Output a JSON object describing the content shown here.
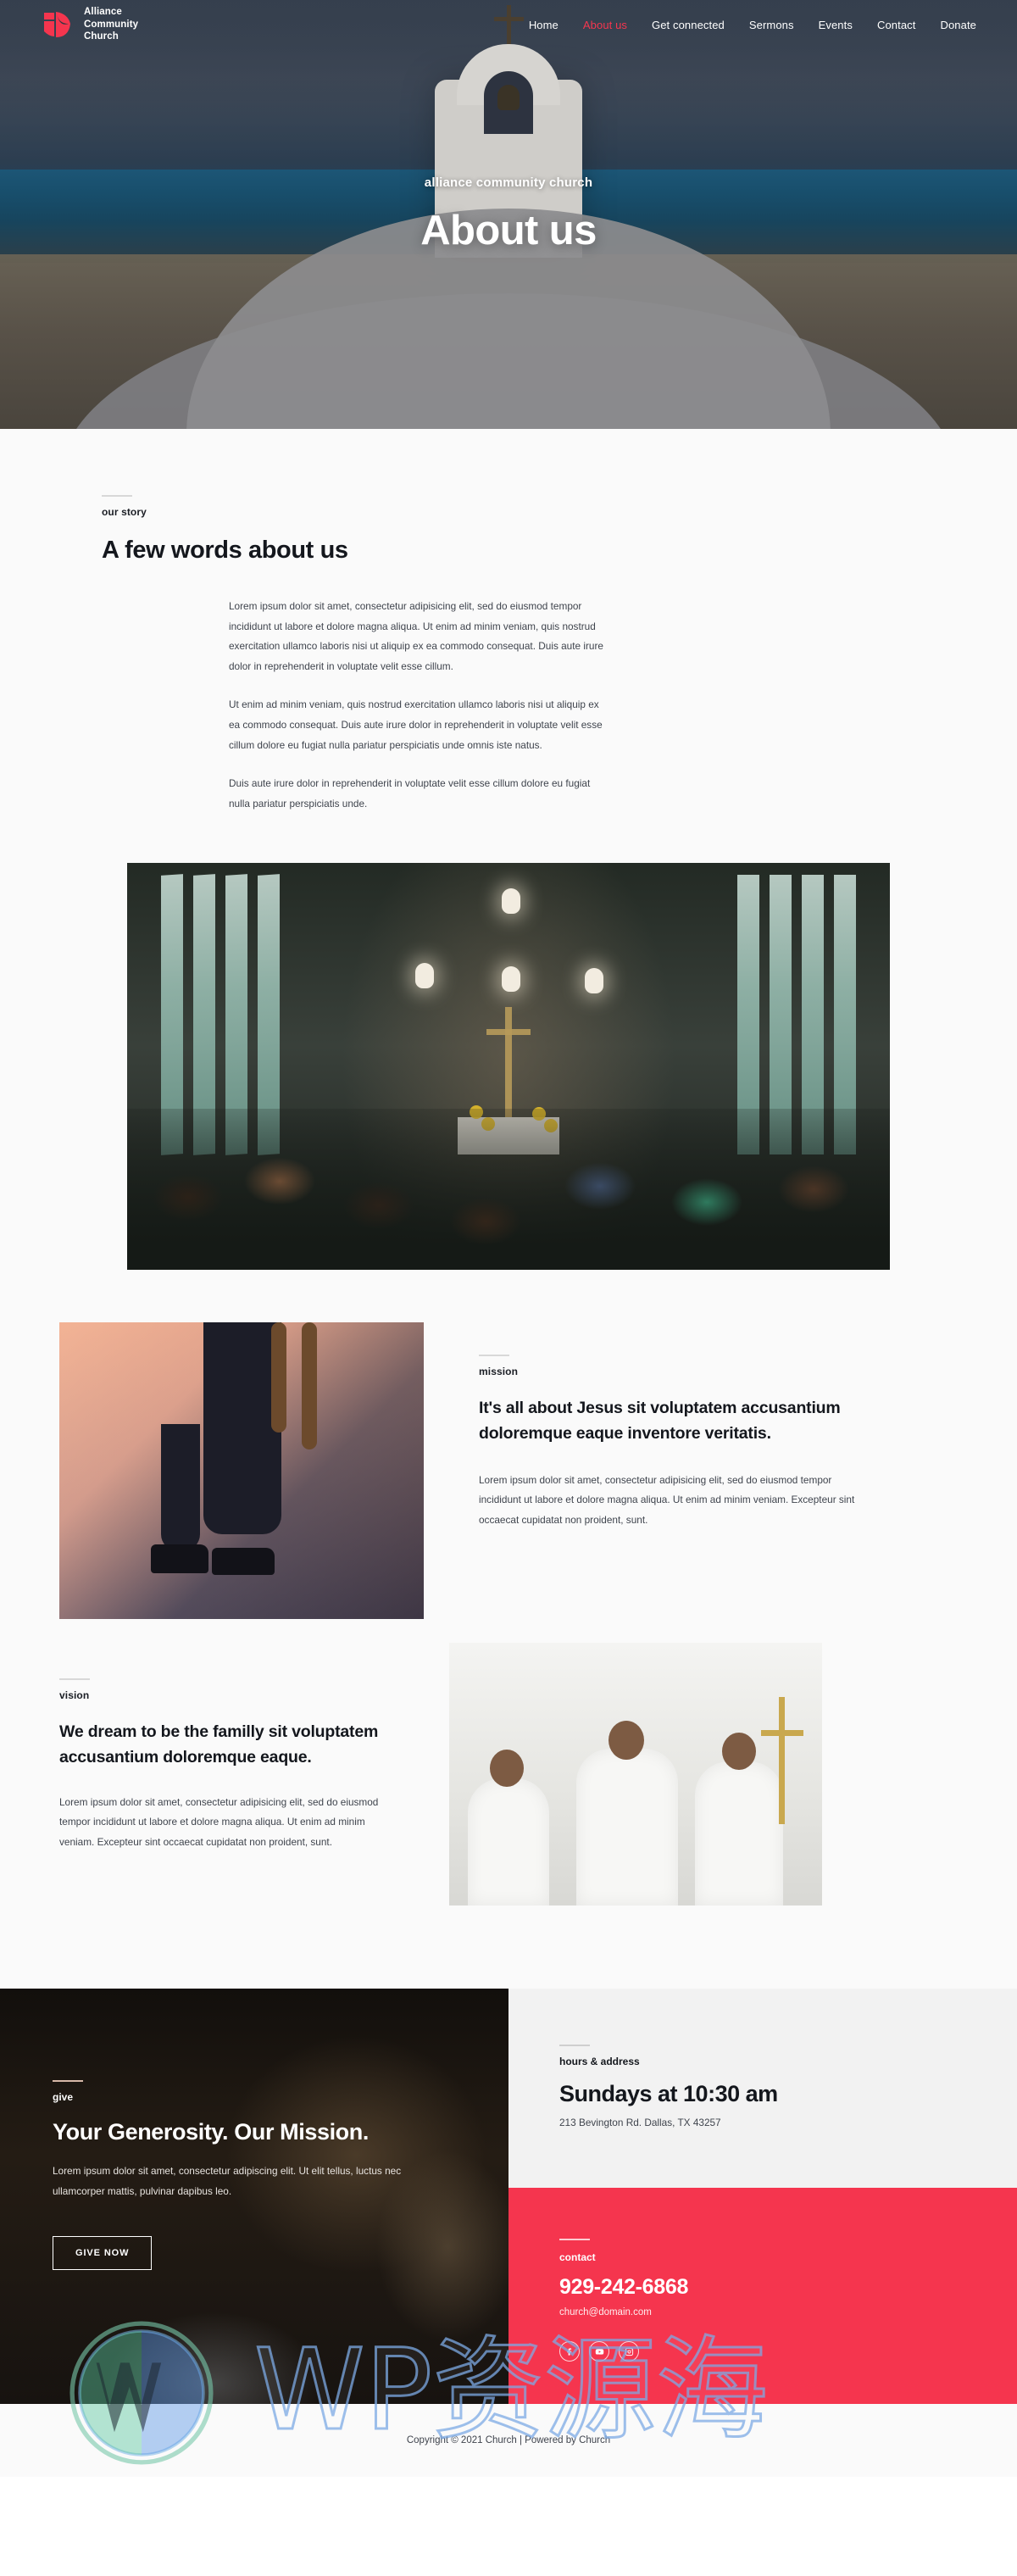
{
  "brand": {
    "line1": "Alliance",
    "line2": "Community",
    "line3": "Church",
    "logo_icon": "church-logo-icon",
    "accent_color": "#f5354e"
  },
  "nav": {
    "items": [
      {
        "label": "Home",
        "active": false
      },
      {
        "label": "About us",
        "active": true
      },
      {
        "label": "Get connected",
        "active": false
      },
      {
        "label": "Sermons",
        "active": false
      },
      {
        "label": "Events",
        "active": false
      },
      {
        "label": "Contact",
        "active": false
      },
      {
        "label": "Donate",
        "active": false
      }
    ]
  },
  "hero": {
    "eyebrow": "alliance community church",
    "title": "About us"
  },
  "story": {
    "eyebrow": "our story",
    "title": "A few words about us",
    "paragraphs": [
      "Lorem ipsum dolor sit amet, consectetur adipisicing elit, sed do eiusmod tempor incididunt ut labore et dolore magna aliqua. Ut enim ad minim veniam, quis nostrud exercitation ullamco laboris nisi ut aliquip ex ea commodo consequat. Duis aute irure dolor in reprehenderit in voluptate velit esse cillum.",
      "Ut enim ad minim veniam, quis nostrud exercitation ullamco laboris nisi ut aliquip ex ea commodo consequat. Duis aute irure dolor in reprehenderit in voluptate velit esse cillum dolore eu fugiat nulla pariatur perspiciatis unde omnis iste natus.",
      "Duis aute irure dolor in reprehenderit in voluptate velit esse cillum dolore eu fugiat nulla pariatur perspiciatis unde."
    ]
  },
  "gallery": {
    "church_interior_alt": "church interior congregation photo"
  },
  "mission": {
    "eyebrow": "mission",
    "heading": "It's all about Jesus sit voluptatem accusantium doloremque eaque inventore veritatis.",
    "paragraph": "Lorem ipsum dolor sit amet, consectetur adipisicing elit, sed do eiusmod tempor incididunt ut labore et dolore magna aliqua. Ut enim ad minim veniam. Excepteur sint occaecat cupidatat non proident, sunt.",
    "image_alt": "pastor standing photo"
  },
  "vision": {
    "eyebrow": "vision",
    "heading": "We dream to be the familly sit voluptatem accusantium doloremque eaque.",
    "paragraph": "Lorem ipsum dolor sit amet, consectetur adipisicing elit, sed do eiusmod tempor incididunt ut labore et dolore magna aliqua. Ut enim ad minim veniam. Excepteur sint occaecat cupidatat non proident, sunt.",
    "image_alt": "priests at altar photo"
  },
  "give": {
    "eyebrow": "give",
    "title": "Your Generosity. Our Mission.",
    "paragraph": "Lorem ipsum dolor sit amet, consectetur adipiscing elit. Ut elit tellus, luctus nec ullamcorper mattis, pulvinar dapibus leo.",
    "button_label": "GIVE NOW"
  },
  "hours": {
    "eyebrow": "hours & address",
    "title": "Sundays at 10:30 am",
    "address": "213 Bevington Rd. Dallas, TX 43257"
  },
  "contact": {
    "eyebrow": "contact",
    "phone": "929-242-6868",
    "email": "church@domain.com",
    "background_color": "#f5354e",
    "socials": [
      {
        "name": "facebook-icon"
      },
      {
        "name": "youtube-icon"
      },
      {
        "name": "instagram-icon"
      }
    ]
  },
  "footer": {
    "copyright": "Copyright © 2021 Church | Powered by Church"
  },
  "watermark": {
    "text": "WP资源海",
    "logo_icon": "wordpress-logo-icon"
  }
}
